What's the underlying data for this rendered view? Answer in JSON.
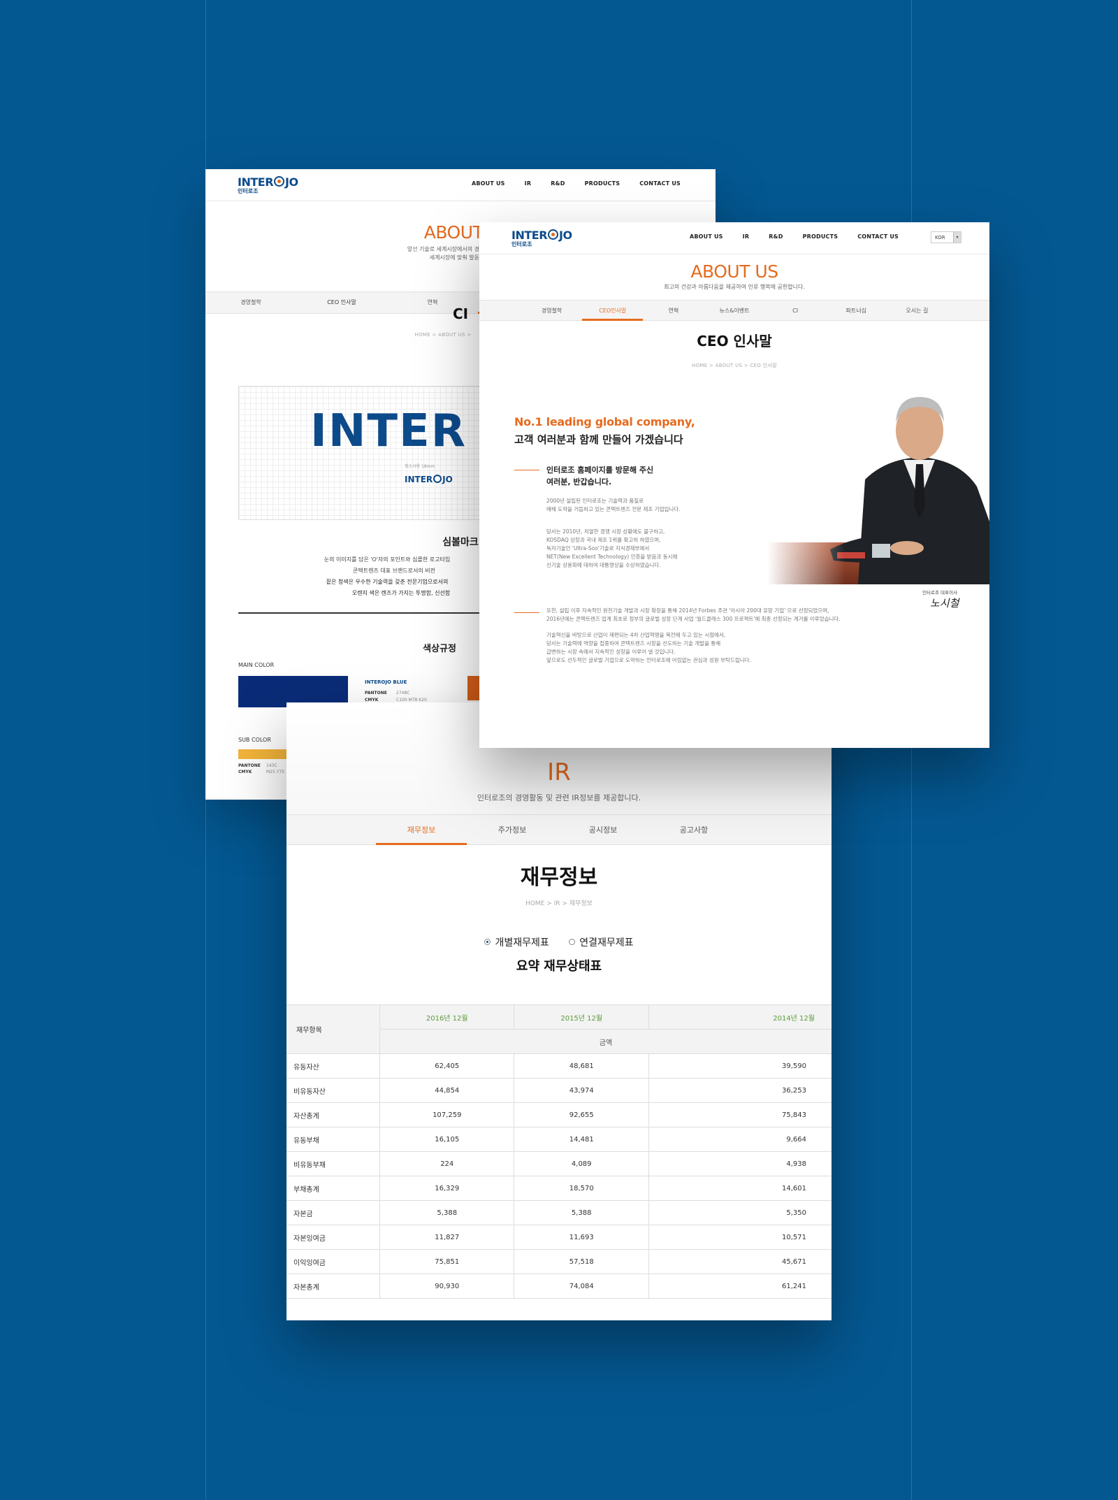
{
  "nav": {
    "logo_en": [
      "INTER",
      "JO"
    ],
    "logo_kr": "인터로조",
    "items": [
      "ABOUT US",
      "IR",
      "R&D",
      "PRODUCTS",
      "CONTACT US"
    ],
    "lang": "KOR"
  },
  "ci_page": {
    "title": "ABOUT",
    "subtitle_lines": [
      "앞선 기술로 세계시장에서의 경쟁력 강화와 글",
      "세계시장에 맞춰 발돋움 하"
    ],
    "tabs": [
      "경영철학",
      "CEO 인사말",
      "연혁",
      ""
    ],
    "heading": "CI",
    "breadcrumb": "HOME  >  ABOUT US  >",
    "logo_big": "INTER",
    "logo_size_note": "최소사용 18mm",
    "logo_small": [
      "INTER",
      "JO"
    ],
    "symbol_title": "심볼마크",
    "symbol_lines": [
      "눈의 이미지를 담은 'O'자의 포인트와 심플한 로고타입",
      "콘택트렌즈 대표 브랜드로서의 비전",
      "짙은 청색은 우수한 기술력을 갖춘 전문기업으로서의",
      "오렌지 색은 렌즈가 가지는 투명함, 신선함"
    ],
    "color_title": "색상규정",
    "main_color_label": "MAIN COLOR",
    "main_color_name": "INTEROJO BLUE",
    "main_color_pantone_label": "PANTONE",
    "main_color_pantone": "2748C",
    "main_color_cmyk_label": "CMYK",
    "main_color_cmyk": "C100 M78 K20",
    "sub_color_label": "SUB COLOR",
    "sub_color_pantone_label": "PANTONE",
    "sub_color_pantone": "143C",
    "sub_color_cmyk_label": "CMYK",
    "sub_color_cmyk": "M25 Y75",
    "colors": {
      "blue": "#0a2c78",
      "orange": "#d8601a",
      "yellow": "#f2b43a"
    }
  },
  "ceo_page": {
    "title": "ABOUT US",
    "subtitle": "최고의 건강과 아름다움을 제공하여 인류 행복에 공헌합니다.",
    "tabs": [
      "경영철학",
      "CEO인사말",
      "연혁",
      "뉴스&이벤트",
      "CI",
      "파트너십",
      "오시는 길"
    ],
    "active_tab": 1,
    "heading": "CEO 인사말",
    "breadcrumb": "HOME  >  ABOUT US  >  CEO 인사말",
    "headline_en": "No.1 leading global company,",
    "headline_kr": "고객 여러분과 함께 만들어 가겠습니다",
    "greeting_lines": [
      "인터로조 홈페이지를 방문해 주신",
      "여러분, 반갑습니다."
    ],
    "para1": [
      "2000년 설립된 인터로조는 기술력과 품질로",
      "매해 도약을 거듭하고 있는 콘택트렌즈 전문 제조 기업입니다."
    ],
    "para2": [
      "당사는 2010년, 치열한 경쟁 시장 상황에도 불구하고,",
      "KOSDAQ 상장과 국내 제조 1위를 확고히 하였으며,",
      "독자기술인 'Ultra-Soo'기술로 지식경제부에서",
      "NET(New Excellent Technology) 인증을 받음과 동시에",
      "신기술 상용화에 대하여 대통령상을 수상하였습니다."
    ],
    "para3": [
      "또한, 설립 이후 지속적인 원천기술 개발과 시장 확장을 통해 2014년 Forbes 주관 '아시아 200대 유망 기업' 으로 선정되었으며,",
      "2016년에는 콘택트렌즈 업계 최초로 정부의 글로벌 성장 단계 사업 '월드클래스 300 프로젝트'에 최종 선정되는 계거를 이루었습니다."
    ],
    "para4": [
      "기술혁신을 바탕으로 산업이 재편되는 4차 산업혁명을 목전에 두고 있는 시점에서,",
      "당사는 기술력에 역량을 집중하여 콘택트렌즈 시장을 선도하는 기술 개발을 통해",
      "급변하는 시장 속에서 지속적인 성장을 이루어 낼 것입니다.",
      "앞으로도 선두적인 글로벌 기업으로 도약하는 인터로조에 아낌없는 관심과 성원 부탁드립니다."
    ],
    "signature_label": "인터로조 대표이사",
    "signature": "노시철"
  },
  "ir_page": {
    "title": "IR",
    "subtitle": "인터로조의 경영활동 및 관련 IR정보를 제공합니다.",
    "tabs": [
      "재무정보",
      "주가정보",
      "공시정보",
      "공고사항"
    ],
    "active_tab": 0,
    "heading": "재무정보",
    "breadcrumb": "HOME  >  IR  >  재무정보",
    "radio_options": [
      "개별재무제표",
      "연결재무제표"
    ],
    "radio_selected": 0,
    "table_title": "요약 재무상태표",
    "table": {
      "corner": "재무항목",
      "years": [
        "2016년 12월",
        "2015년 12월",
        "2014년 12월"
      ],
      "unit": "금액",
      "rows": [
        {
          "label": "유동자산",
          "values": [
            "62,405",
            "48,681",
            "39,590"
          ]
        },
        {
          "label": "비유동자산",
          "values": [
            "44,854",
            "43,974",
            "36,253"
          ]
        },
        {
          "label": "자산총계",
          "values": [
            "107,259",
            "92,655",
            "75,843"
          ]
        },
        {
          "label": "유동부채",
          "values": [
            "16,105",
            "14,481",
            "9,664"
          ]
        },
        {
          "label": "비유동부채",
          "values": [
            "224",
            "4,089",
            "4,938"
          ]
        },
        {
          "label": "부채총계",
          "values": [
            "16,329",
            "18,570",
            "14,601"
          ]
        },
        {
          "label": "자본금",
          "values": [
            "5,388",
            "5,388",
            "5,350"
          ]
        },
        {
          "label": "자본잉여금",
          "values": [
            "11,827",
            "11,693",
            "10,571"
          ]
        },
        {
          "label": "이익잉여금",
          "values": [
            "75,851",
            "57,518",
            "45,671"
          ]
        },
        {
          "label": "자본총계",
          "values": [
            "90,930",
            "74,084",
            "61,241"
          ]
        }
      ]
    }
  }
}
